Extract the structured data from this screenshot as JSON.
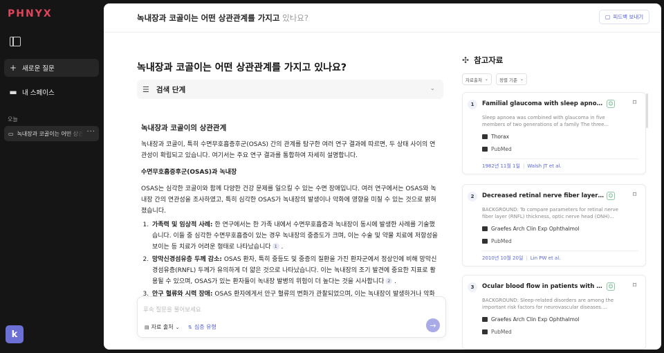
{
  "app": {
    "logo": "PHNYX"
  },
  "sidebar": {
    "new_question": "새로운 질문",
    "my_space": "내 스페이스",
    "today_label": "오늘",
    "history": [
      {
        "label": "녹내장과 코골이는 어떤 상관관계를 가지고 있나요?"
      }
    ],
    "avatar_letter": "k"
  },
  "header": {
    "title_main": "녹내장과 코골이는 어떤 상관관계를 가지고",
    "title_fade": " 있나요?",
    "feedback_label": "피드백 보내기"
  },
  "main": {
    "question": "녹내장과 코골이는 어떤 상관관계를 가지고 있나요?",
    "search_steps_label": "검색 단계",
    "answer": {
      "heading": "녹내장과 코골이의 상관관계",
      "intro": "녹내장과 코골이, 특히 수면무호흡증후군(OSAS) 간의 관계를 탐구한 여러 연구 결과에 따르면, 두 상태 사이의 연관성이 확립되고 있습니다. 여기서는 주요 연구 결과를 통합하여 자세히 설명합니다.",
      "subheading": "수면무호흡증후군(OSAS)과 녹내장",
      "para": "OSAS는 심각한 코골이와 함께 다양한 건강 문제를 일으킬 수 있는 수면 장애입니다. 여러 연구에서는 OSAS와 녹내장 간의 연관성을 조사하였고, 특히 심각한 OSAS가 녹내장의 발생이나 악화에 영향을 미칠 수 있는 것으로 밝혀졌습니다.",
      "items": [
        {
          "bold": "가족력 및 임상적 사례:",
          "text": " 한 연구에서는 한 가족 내에서 수면무호흡증과 녹내장이 동시에 발생한 사례를 기술했습니다. 이들 중 심각한 수면무호흡증이 있는 경우 녹내장의 중증도가 크며, 이는 수술 및 약물 치료에 저항성을 보이는 등 치료가 어려운 형태로 나타났습니다",
          "cite": "1"
        },
        {
          "bold": "망막신경섬유층 두께 감소:",
          "text": " OSAS 환자, 특히 중등도 및 중증의 질환을 가진 환자군에서 정상인에 비해 망막신경섬유층(RNFL) 두께가 유의하게 더 얇은 것으로 나타났습니다. 이는 녹내장의 조기 발견에 중요한 지표로 활용될 수 있으며, OSAS가 있는 환자들이 녹내장 발병의 위험이 더 높다는 것을 시사합니다",
          "cite": "2"
        },
        {
          "bold": "안구 혈류와 시력 장애:",
          "text": " OSAS 환자에게서 안구 혈류의 변화가 관찰되었으며, 이는 녹내장이 발생하거나 악화될 수 있는 잠재적 병리 기전을 제공합니다. 심각한 OSAS와 높은 안압 및 시야 결함 간의 양의 상관관계가 보고되었는데, 이는 OSAS가 안구 내 혈류를 감소시켜 녹내장의 진행을 촉진할 수 있음을 암시합니다",
          "cite": "3"
        }
      ]
    },
    "followup": {
      "placeholder": "후속 질문을 물어보세요",
      "source_label": "자료 출처",
      "depth_label": "심층 유형"
    }
  },
  "references": {
    "title": "참고자료",
    "filters": [
      "자료출처",
      "정렬 기준"
    ],
    "cards": [
      {
        "num": "1",
        "title": "Familial glaucoma with sleep apnoea: a n...",
        "abstract": "Sleep apnoea was combined with glaucoma in five members of two generations of a family The three...",
        "journal": "Thorax",
        "database": "PubMed",
        "date": "1982년 11월 1일",
        "authors": "Walsh JT et al."
      },
      {
        "num": "2",
        "title": "Decreased retinal nerve fiber layer thick...",
        "abstract": "BACKGROUND: To compare parameters for retinal nerve fiber layer (RNFL) thickness, optic nerve head (ONH)...",
        "journal": "Graefes Arch Clin Exp Ophthalmol",
        "database": "PubMed",
        "date": "2010년 10월 20일",
        "authors": "Lin PW et al."
      },
      {
        "num": "3",
        "title": "Ocular blood flow in patients with obstru...",
        "abstract": "BACKGROUND: Sleep-related disorders are among the important risk factors for neurovascular diseases....",
        "journal": "Graefes Arch Clin Exp Ophthalmol",
        "database": "PubMed",
        "date": "",
        "authors": ""
      }
    ]
  }
}
